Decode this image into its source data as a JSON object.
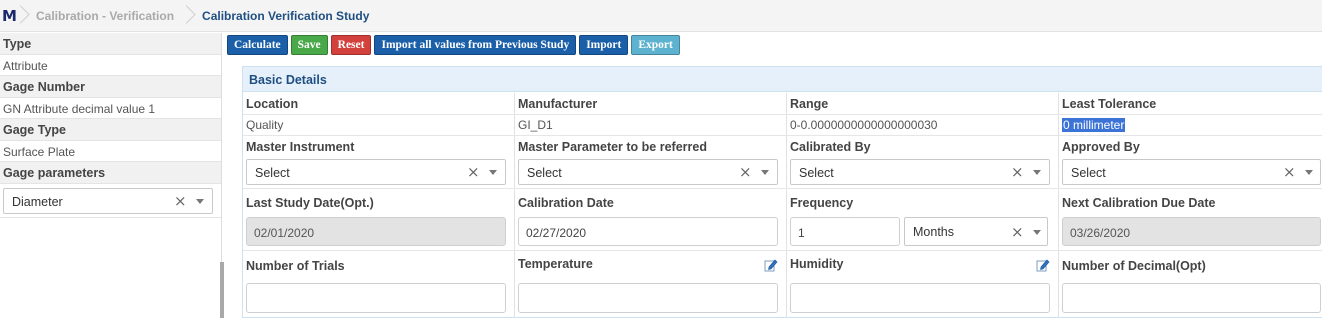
{
  "breadcrumb": {
    "logo": "M",
    "items": [
      "Calibration - Verification",
      "Calibration Verification Study"
    ]
  },
  "sidebar": {
    "type_label": "Type",
    "type_value": "Attribute",
    "gage_number_label": "Gage Number",
    "gage_number_value": "GN Attribute decimal value 1",
    "gage_type_label": "Gage Type",
    "gage_type_value": "Surface Plate",
    "gage_params_label": "Gage parameters",
    "gage_params_value": "Diameter"
  },
  "toolbar": {
    "calculate": "Calculate",
    "save": "Save",
    "reset": "Reset",
    "import_prev": "Import all values from Previous Study",
    "import": "Import",
    "export": "Export"
  },
  "panel": {
    "title": "Basic Details",
    "location_label": "Location",
    "location_value": "Quality",
    "manufacturer_label": "Manufacturer",
    "manufacturer_value": "GI_D1",
    "range_label": "Range",
    "range_value": "0-0.0000000000000000030",
    "least_tol_label": "Least Tolerance",
    "least_tol_value": "0 millimeter",
    "master_instrument_label": "Master Instrument",
    "master_instrument_value": "Select",
    "master_param_label": "Master Parameter to be referred",
    "master_param_value": "Select",
    "calibrated_by_label": "Calibrated By",
    "calibrated_by_value": "Select",
    "approved_by_label": "Approved By",
    "approved_by_value": "Select",
    "last_study_label": "Last Study Date(Opt.)",
    "last_study_value": "02/01/2020",
    "calibration_date_label": "Calibration Date",
    "calibration_date_value": "02/27/2020",
    "frequency_label": "Frequency",
    "frequency_value": "1",
    "frequency_unit": "Months",
    "next_due_label": "Next Calibration Due Date",
    "next_due_value": "03/26/2020",
    "trials_label": "Number of Trials",
    "trials_value": "",
    "temperature_label": "Temperature",
    "temperature_value": "",
    "humidity_label": "Humidity",
    "humidity_value": "",
    "decimal_label": "Number of Decimal(Opt)",
    "decimal_value": ""
  },
  "icons": {
    "clear": "×",
    "edit": "pencil-icon"
  },
  "colors": {
    "primary_blue": "#1a5fa8",
    "save_green": "#49a848",
    "reset_red": "#d2413c",
    "export_light": "#5cb2cf",
    "header_text": "#1f4f82",
    "panel_header_bg": "#e6f0fa"
  }
}
